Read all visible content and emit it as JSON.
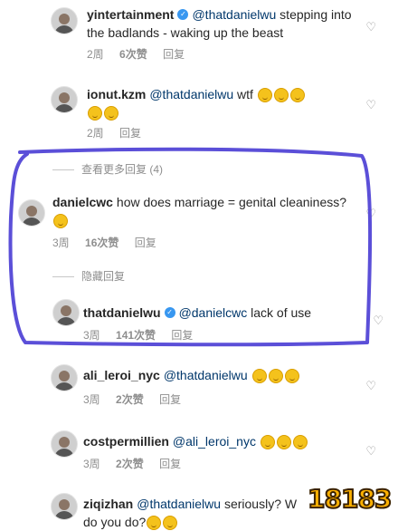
{
  "comments": [
    {
      "user": "yintertainment",
      "verified": true,
      "mention": "@thatdanielwu",
      "text": " stepping into the badlands - waking up the beast",
      "emojis": 0,
      "time": "2周",
      "likes": "6次赞",
      "reply": "回复"
    },
    {
      "user": "ionut.kzm",
      "verified": false,
      "mention": "@thatdanielwu",
      "text": " wtf ",
      "emojis": 5,
      "time": "2周",
      "likes": "",
      "reply": "回复"
    },
    {
      "user": "danielcwc",
      "verified": false,
      "mention": "",
      "text": "how does marriage = genital cleaniness? ",
      "emojis": 1,
      "time": "3周",
      "likes": "16次赞",
      "reply": "回复"
    },
    {
      "user": "thatdanielwu",
      "verified": true,
      "mention": "@danielcwc",
      "text": " lack of use",
      "emojis": 0,
      "time": "3周",
      "likes": "141次赞",
      "reply": "回复"
    },
    {
      "user": "ali_leroi_nyc",
      "verified": false,
      "mention": "@thatdanielwu",
      "text": " ",
      "emojis": 3,
      "time": "3周",
      "likes": "2次赞",
      "reply": "回复"
    },
    {
      "user": "costpermillien",
      "verified": false,
      "mention": "@ali_leroi_nyc",
      "text": " ",
      "emojis": 3,
      "time": "3周",
      "likes": "2次赞",
      "reply": "回复"
    },
    {
      "user": "ziqizhan",
      "verified": false,
      "mention": "@thatdanielwu",
      "text": " seriously? W",
      "text2": "do you do?",
      "emojis": 2,
      "time": "",
      "likes": "",
      "reply": ""
    }
  ],
  "threads": {
    "view_more": "查看更多回复 (4)",
    "hide": "隐藏回复"
  },
  "watermark": "18183",
  "colors": {
    "annotation": "#5b4fd8",
    "mention": "#00376b",
    "meta": "#8e8e8e",
    "verified": "#3897f0"
  }
}
